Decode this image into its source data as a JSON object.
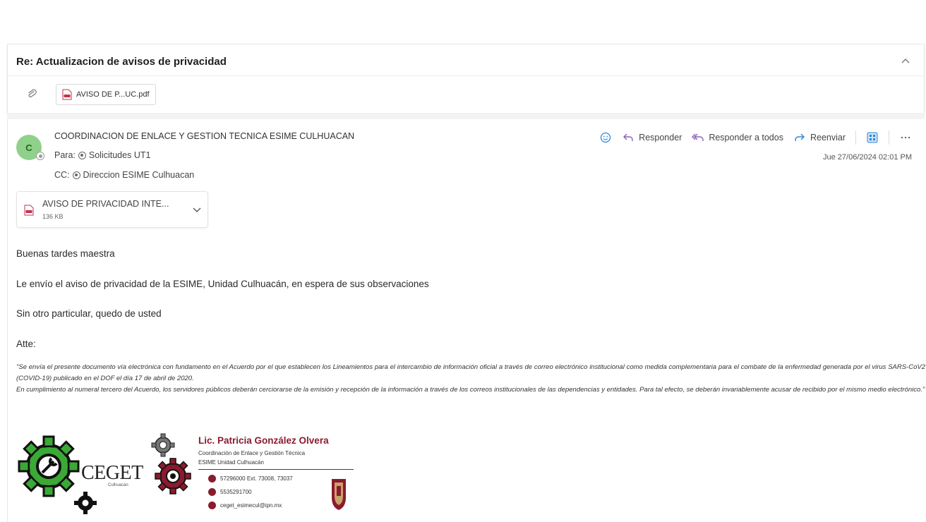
{
  "email": {
    "subject": "Re: Actualizacion de avisos de privacidad",
    "top_attachment_label": "AVISO DE P...UC.pdf",
    "sender_initial": "C",
    "sender_name": "COORDINACION DE ENLACE Y GESTION TECNICA ESIME CULHUACAN",
    "to_label": "Para:",
    "to_value": "Solicitudes UT1",
    "cc_label": "CC:",
    "cc_value": "Direccion ESIME Culhuacan",
    "date": "Jue 27/06/2024 02:01 PM",
    "actions": {
      "reply": "Responder",
      "reply_all": "Responder a todos",
      "forward": "Reenviar"
    },
    "attachment": {
      "name": "AVISO DE PRIVACIDAD INTE...",
      "size": "136 KB"
    },
    "body": {
      "greeting": "Buenas tardes maestra",
      "line1": "Le envío el aviso de privacidad de la ESIME, Unidad Culhuacán, en espera de sus observaciones",
      "line2": "Sin otro particular, quedo de usted",
      "closing": "Atte:"
    },
    "disclaimer": {
      "p1": "\"Se envía el presente documento vía electrónica con fundamento en el Acuerdo por el que establecen los Lineamientos para el intercambio de información oficial a través de correo electrónico institucional como medida complementaria para el combate de la enfermedad generada por el virus SARS-CoV2 (COVID-19) publicado en el DOF el día 17 de abril de 2020.",
      "p2": "En cumplimiento al numeral tercero del Acuerdo, los servidores públicos deberán cerciorarse de la emisión y recepción de la información a través de los correos institucionales de las dependencias y entidades. Para tal efecto, se deberán invariablemente acusar de recibido por el mismo medio electrónico.\""
    },
    "signature": {
      "logo_text": "CEGET",
      "logo_subtext": "Culhuacán",
      "name": "Lic. Patricia González Olvera",
      "title": "Coordinación de Enlace y Gestión Técnica",
      "unit": "ESIME Unidad Culhuacán",
      "phone": "57296000 Ext. 73008, 73037",
      "mobile": "5535291700",
      "email": "ceget_esimecul@ipn.mx"
    }
  },
  "colors": {
    "brand_red": "#8a1b2e",
    "link_blue": "#2b88d8",
    "reply_purple": "#8764b8",
    "avatar_green": "#8fd18b",
    "gear_green": "#3aa935"
  }
}
